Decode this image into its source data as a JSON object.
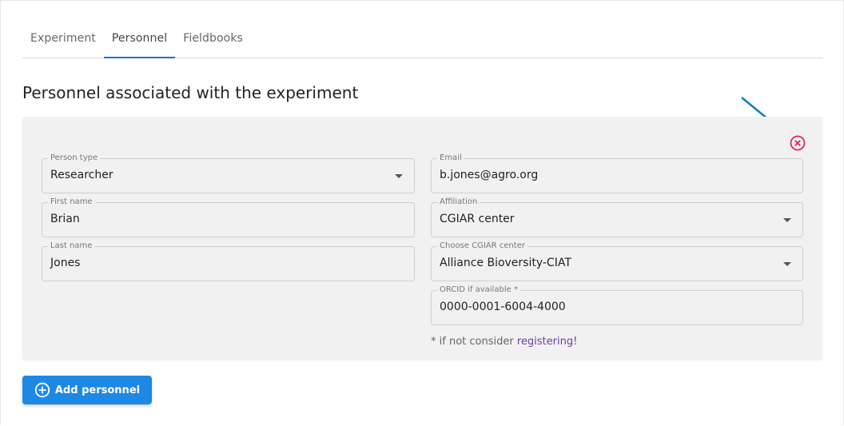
{
  "tabs": [
    {
      "label": "Experiment",
      "active": false
    },
    {
      "label": "Personnel",
      "active": true
    },
    {
      "label": "Fieldbooks",
      "active": false
    }
  ],
  "section": {
    "title": "Personnel associated with the experiment"
  },
  "person": {
    "person_type": {
      "label": "Person type",
      "value": "Researcher"
    },
    "first_name": {
      "label": "First name",
      "value": "Brian"
    },
    "last_name": {
      "label": "Last name",
      "value": "Jones"
    },
    "email": {
      "label": "Email",
      "value": "b.jones@agro.org"
    },
    "affiliation": {
      "label": "Affiliation",
      "value": "CGIAR center"
    },
    "cgiar_center": {
      "label": "Choose CGIAR center",
      "value": "Alliance Bioversity-CIAT"
    },
    "orcid": {
      "label": "ORCID if available *",
      "value": "0000-0001-6004-4000"
    },
    "hint_text": "* if not consider ",
    "hint_link": "registering!"
  },
  "actions": {
    "add_personnel_label": "Add personnel"
  },
  "colors": {
    "accent": "#1976d2",
    "button": "#1e88e5",
    "remove": "#e0245e",
    "arrow": "#0a7bc1",
    "link": "#6b3fa0"
  },
  "icons": {
    "remove": "close-circle-icon",
    "add": "plus-circle-icon",
    "dropdown": "caret-down-icon"
  }
}
